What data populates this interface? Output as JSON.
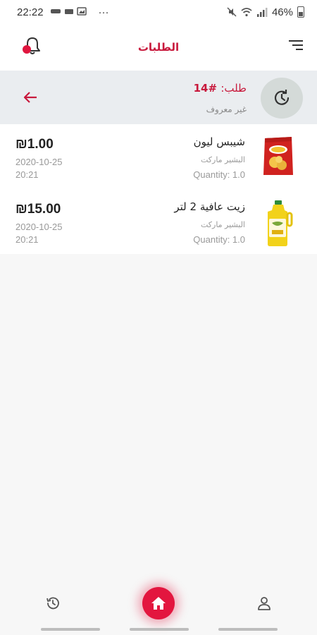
{
  "status_bar": {
    "time": "22:22",
    "more": "···",
    "battery": "46%"
  },
  "header": {
    "title": "الطلبات"
  },
  "order": {
    "label": "طلب:",
    "number": "#14",
    "status": "غير معروف"
  },
  "items": [
    {
      "name": "شيبس ليون",
      "store": "البشير ماركت",
      "quantity": "Quantity: 1.0",
      "price": "₪1.00",
      "date": "2020-10-25",
      "time": "20:21",
      "image": "chips-bag-image"
    },
    {
      "name": "زيت عافية 2 لتر",
      "store": "البشير ماركت",
      "quantity": "Quantity: 1.0",
      "price": "₪15.00",
      "date": "2020-10-25",
      "time": "20:21",
      "image": "oil-bottle-image"
    }
  ],
  "bottom_nav": {
    "left_icon": "history-icon",
    "center_icon": "home-icon",
    "right_icon": "profile-icon"
  },
  "colors": {
    "accent": "#c8193c",
    "home_button": "#e3163f",
    "order_header_bg": "#eaedf0",
    "avatar_bg": "#d4dad8"
  }
}
